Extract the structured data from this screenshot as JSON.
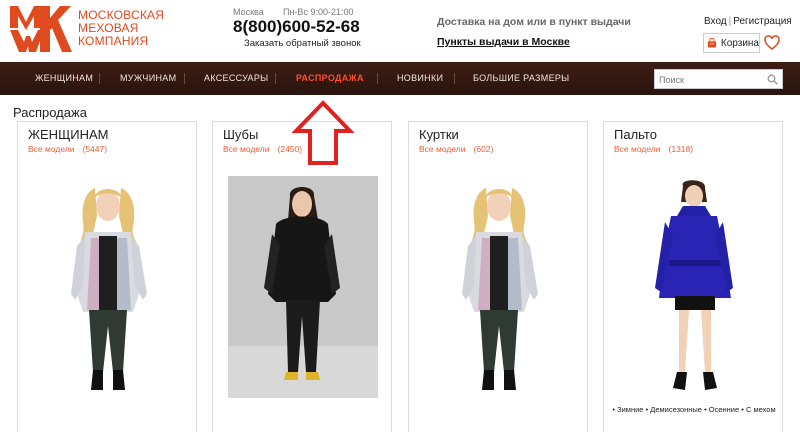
{
  "header": {
    "logo_lines": [
      "МОСКОВСКАЯ",
      "МЕХОВАЯ",
      "КОМПАНИЯ"
    ],
    "city": "Москва",
    "hours": "Пн-Вс 9:00-21:00",
    "phone": "8(800)600-52-68",
    "callback": "Заказать обратный звонок",
    "delivery": "Доставка на дом или в пункт выдачи",
    "pickup_link": "Пункты выдачи в Москве",
    "login": "Вход",
    "auth_sep": "|",
    "register": "Регистрация",
    "cart_label": "Корзина"
  },
  "nav": {
    "items": [
      "ЖЕНЩИНАМ",
      "МУЖЧИНАМ",
      "АКСЕССУАРЫ",
      "РАСПРОДАЖА",
      "НОВИНКИ",
      "БОЛЬШИЕ РАЗМЕРЫ"
    ],
    "active_index": 3,
    "search_placeholder": "Поиск"
  },
  "page": {
    "title": "Распродажа"
  },
  "cards": [
    {
      "title": "ЖЕНЩИНАМ",
      "link_label": "Все модели",
      "count": "(5447)",
      "tags": ""
    },
    {
      "title": "Шубы",
      "link_label": "Все модели",
      "count": "(2450)",
      "tags": ""
    },
    {
      "title": "Куртки",
      "link_label": "Все модели",
      "count": "(602)",
      "tags": ""
    },
    {
      "title": "Пальто",
      "link_label": "Все модели",
      "count": "(1318)",
      "tags": "• Зимние • Демисезонные • Осенние • С мехом"
    }
  ],
  "colors": {
    "brand": "#e04a1f",
    "nav_bg": "#2f170f",
    "nav_active": "#ff4b2e",
    "link": "#e8603a",
    "arrow": "#e0211e"
  }
}
